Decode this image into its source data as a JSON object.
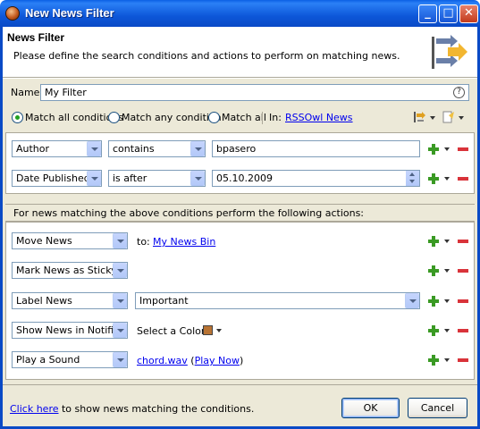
{
  "window": {
    "title": "New News Filter",
    "controls": [
      "minimize",
      "maximize",
      "close"
    ]
  },
  "header": {
    "title": "News Filter",
    "description": "Please define the search conditions and actions to perform on matching news.",
    "image_icon": "filter-arrows-icon"
  },
  "name_field": {
    "label": "Name:",
    "value": "My Filter",
    "help_glyph": "?"
  },
  "match_mode": {
    "options": [
      {
        "label": "Match all conditions",
        "selected": true
      },
      {
        "label": "Match any condition",
        "selected": false
      },
      {
        "label": "Match all",
        "selected": false
      }
    ],
    "in_label": "In:",
    "scope_link": "RSSOwl News"
  },
  "conditions": [
    {
      "field": "Author",
      "operator": "contains",
      "value": "bpasero",
      "value_kind": "text"
    },
    {
      "field": "Date Published",
      "operator": "is after",
      "value": "05.10.2009",
      "value_kind": "date"
    }
  ],
  "actions_heading": "For news matching the above conditions perform the following actions:",
  "actions": [
    {
      "action": "Move News",
      "detail_label": "to:",
      "detail_link": "My News Bin"
    },
    {
      "action": "Mark News as Sticky"
    },
    {
      "action": "Label News",
      "detail_select": "Important"
    },
    {
      "action": "Show News in Notifier",
      "detail_label": "Select a Color:",
      "color": "#b87333"
    },
    {
      "action": "Play a Sound",
      "detail_link": "chord.wav",
      "detail_link_open": " (",
      "detail_link2": "Play Now",
      "detail_link_close": ")"
    }
  ],
  "footer": {
    "preview_link": "Click here",
    "preview_text": " to show news matching the conditions.",
    "ok_label": "OK",
    "cancel_label": "Cancel"
  },
  "colors": {
    "title_bar": "#0a4ac6",
    "dialog_bg": "#ece9d8",
    "add_green": "#3a9a24",
    "remove_red": "#d9333a",
    "link_blue": "#0000ee"
  }
}
